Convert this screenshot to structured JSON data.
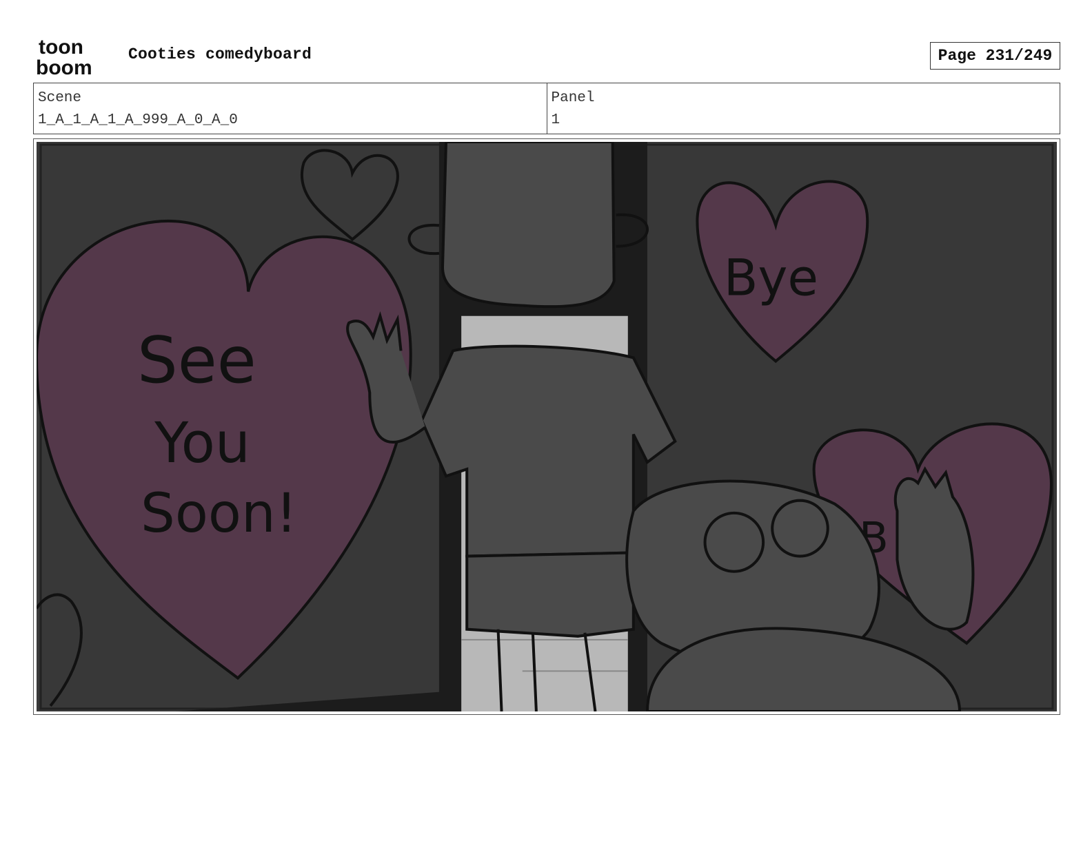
{
  "header": {
    "logo_text_top": "toon",
    "logo_text_bottom": "boom",
    "title": "Cooties comedyboard",
    "page": "Page 231/249"
  },
  "info": {
    "scene_label": "Scene",
    "scene_value": "1_A_1_A_1_A_999_A_0_A_0",
    "panel_label": "Panel",
    "panel_value": "1"
  },
  "panel_art": {
    "heart_left_text_1": "See",
    "heart_left_text_2": "You",
    "heart_left_text_3": "Soon!",
    "heart_right_text": "Bye",
    "heart_bottom_text": "B"
  },
  "colors": {
    "background": "#383838",
    "heart": "#54384a",
    "character": "#4a4a4a",
    "doorway": "#b8b8b8",
    "ink": "#111111"
  }
}
